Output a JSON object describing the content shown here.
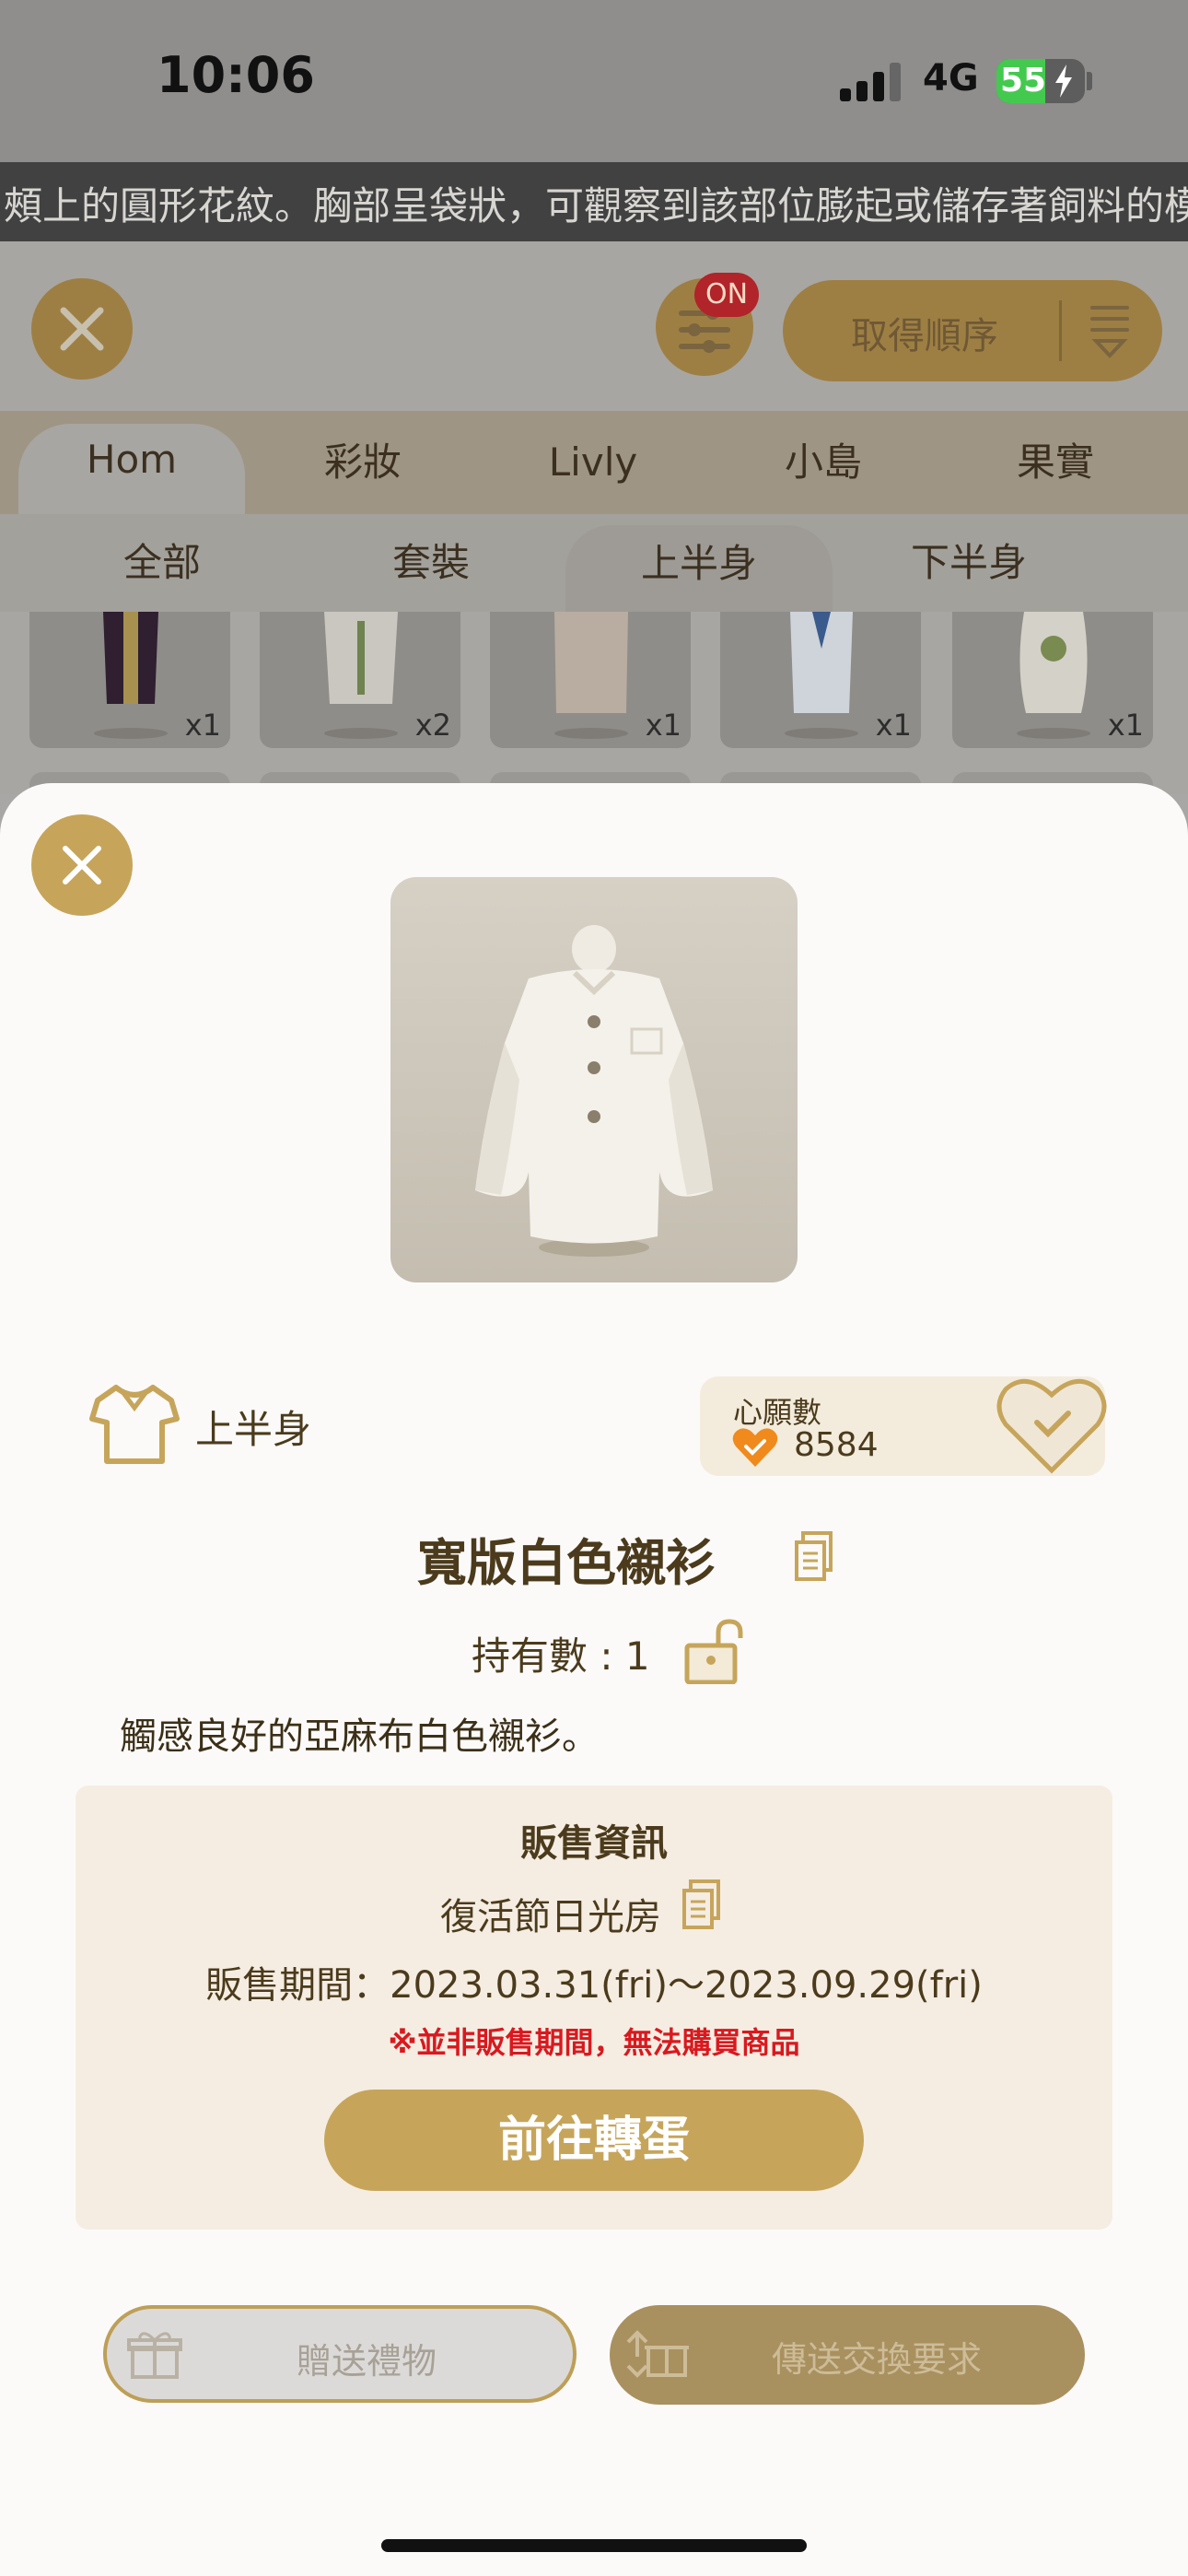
{
  "status_bar": {
    "time": "10:06",
    "network": "4G",
    "battery": "55",
    "battery_level": 0.55
  },
  "marquee": {
    "text": "頰上的圓形花紋。胸部呈袋狀，可觀察到該部位膨起或儲存著飼料的模樣"
  },
  "background_app": {
    "filter_badge": "ON",
    "sort_label": "取得順序",
    "tabs_main": [
      "Hom",
      "彩妝",
      "Livly",
      "小島",
      "果實"
    ],
    "tabs_main_active": "Hom",
    "tabs_sub": [
      "全部",
      "套裝",
      "上半身",
      "下半身"
    ],
    "tabs_sub_active": "上半身",
    "items": [
      {
        "count": "x1",
        "color": "#3b2438"
      },
      {
        "count": "x2",
        "color": "#d8d6cd"
      },
      {
        "count": "x1",
        "color": "#e9dbc2"
      },
      {
        "count": "x1",
        "color": "#e8ecf2"
      },
      {
        "count": "x1",
        "color": "#eeeae0"
      }
    ]
  },
  "modal": {
    "category": "上半身",
    "wish_label": "心願數",
    "wish_count": "8584",
    "item_name": "寬版白色襯衫",
    "owned": "持有數 : 1",
    "description": "觸感良好的亞麻布白色襯衫。",
    "sale": {
      "title": "販售資訊",
      "shop": "復活節日光房",
      "period": "販售期間：2023.03.31(fri)～2023.09.29(fri)",
      "warning": "※並非販售期間，無法購買商品"
    },
    "goto_button": "前往轉蛋",
    "gift_button": "贈送禮物",
    "trade_button": "傳送交換要求"
  },
  "colors": {
    "accent": "#c6a55b",
    "text": "#4b3b1c",
    "warning": "#d9191f",
    "wish_orange": "#f08a1c"
  }
}
